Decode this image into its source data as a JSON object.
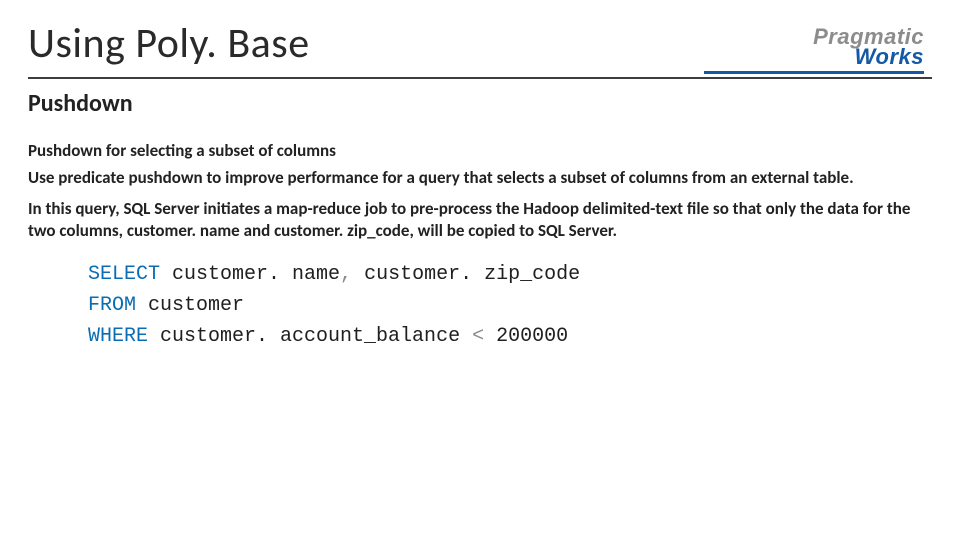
{
  "title": "Using Poly. Base",
  "subtitle": "Pushdown",
  "section_head": "Pushdown for selecting a subset of columns",
  "para1": "Use predicate pushdown to improve performance for a query that selects a subset of columns from an external table.",
  "para2": "In this query, SQL Server initiates a map-reduce job to pre-process the Hadoop delimited-text file so that only the data for the two columns, customer. name and customer. zip_code, will be copied to SQL Server.",
  "code": {
    "kw_select": "SELECT",
    "sel_cols": " customer. name",
    "comma": ",",
    "sel_cols2": " customer. zip_code",
    "kw_from": "FROM",
    "from_tbl": " customer",
    "kw_where": "WHERE",
    "where_expr": " customer. account_balance ",
    "lt": "<",
    "where_val": " 200000"
  },
  "logo": {
    "top": "Pragmatic",
    "bottom": "Works"
  }
}
